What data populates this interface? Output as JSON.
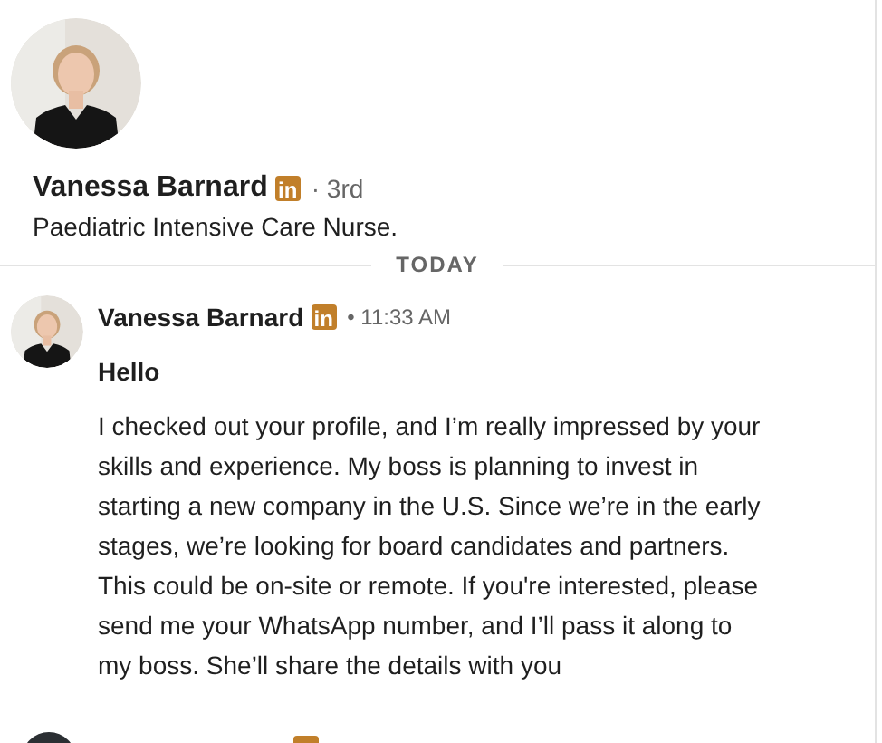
{
  "profile": {
    "name": "Vanessa Barnard",
    "badge": "in",
    "degree": "· 3rd",
    "headline": "Paediatric Intensive Care Nurse."
  },
  "day_divider": "TODAY",
  "messages": [
    {
      "kind": "full",
      "sender": "Vanessa Barnard",
      "badge": "in",
      "time": "• 11:33 AM",
      "greeting": "Hello",
      "body": "I checked out your profile, and I’m really impressed by your skills and experience. My boss is planning to invest in starting a new company in the U.S. Since we’re in the early stages, we’re looking for board candidates and partners. This could be on-site or remote. If you're interested, please send me your WhatsApp number, and I’ll pass it along to my boss. She’ll share the details with you"
    },
    {
      "kind": "cut-off"
    }
  ]
}
